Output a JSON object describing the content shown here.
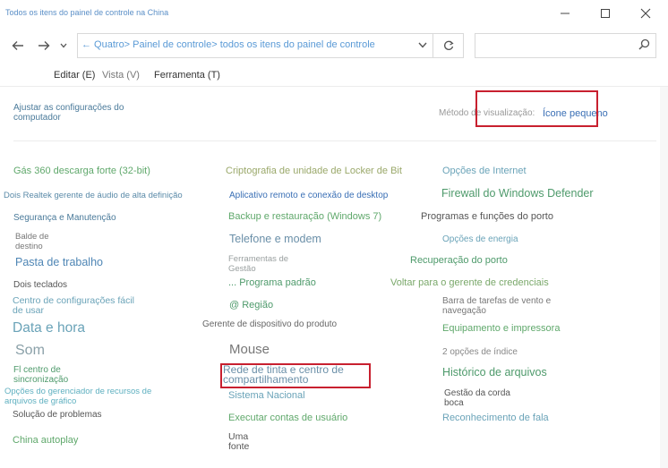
{
  "window": {
    "title": "Todos os itens do painel de controle na China"
  },
  "toolbar": {
    "address": "← Quatro> Painel de controle> todos os itens do painel de controle",
    "search_placeholder": ""
  },
  "menu": {
    "edit": "Editar (E)",
    "view": "Vista (V)",
    "tools": "Ferramenta (T)"
  },
  "header": {
    "adjust": "Ajustar as configurações do computador",
    "view_label": "Método de visualização:",
    "view_value": "Ícone pequeno"
  },
  "items": [
    {
      "label": "Gás 360 descarga forte (32-bit)"
    },
    {
      "label": "Dois Realtek gerente de áudio de alta definição"
    },
    {
      "label": "Segurança e Manutenção"
    },
    {
      "label": "Balde de destino"
    },
    {
      "label": "Pasta de trabalho"
    },
    {
      "label": "Dois teclados"
    },
    {
      "label": "Centro de configurações fácil de usar"
    },
    {
      "label": "Data e hora"
    },
    {
      "label": "Som"
    },
    {
      "label": "Fl centro de sincronização"
    },
    {
      "label": "Opções do gerenciador de recursos de arquivos de gráfico"
    },
    {
      "label": "Solução de problemas"
    },
    {
      "label": "China autoplay"
    },
    {
      "label": "Criptografia de unidade de Locker de Bit"
    },
    {
      "label": "Aplicativo remoto e conexão de desktop"
    },
    {
      "label": "Backup e restauração (Windows 7)"
    },
    {
      "label": "Telefone e modem"
    },
    {
      "label": "Ferramentas de Gestão"
    },
    {
      "label": "... Programa padrão"
    },
    {
      "label": "@ Região"
    },
    {
      "label": "Gerente de dispositivo do produto"
    },
    {
      "label": "Mouse"
    },
    {
      "label": "Rede de tinta e centro de compartilhamento"
    },
    {
      "label": "Sistema Nacional"
    },
    {
      "label": "Executar contas de usuário"
    },
    {
      "label": "Uma fonte"
    },
    {
      "label": "Opções de Internet"
    },
    {
      "label": "Firewall do Windows Defender"
    },
    {
      "label": "Programas e funções do porto"
    },
    {
      "label": "Opções de energia"
    },
    {
      "label": "Recuperação do porto"
    },
    {
      "label": "Voltar para o gerente de credenciais"
    },
    {
      "label": "Barra de tarefas de vento e navegação"
    },
    {
      "label": "Equipamento e impressora"
    },
    {
      "label": "2 opções de índice"
    },
    {
      "label": "Histórico de arquivos"
    },
    {
      "label": "Gestão da corda boca"
    },
    {
      "label": "Reconhecimento de fala"
    }
  ]
}
